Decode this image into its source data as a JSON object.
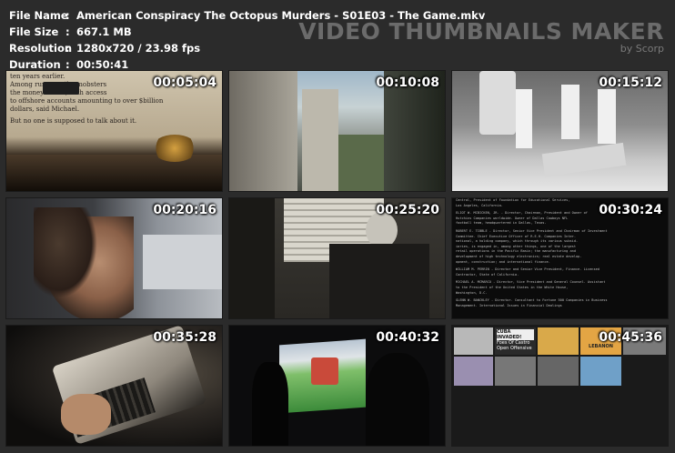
{
  "info": {
    "rows": [
      {
        "key": "File Name",
        "sep": ":",
        "value": "American Conspiracy The Octopus Murders - S01E03 - The Game.mkv"
      },
      {
        "key": "File Size",
        "sep": ":",
        "value": "667.1 MB"
      },
      {
        "key": "Resolution",
        "sep": ":",
        "value": "1280x720 / 23.98 fps"
      },
      {
        "key": "Duration",
        "sep": ":",
        "value": "00:50:41"
      }
    ]
  },
  "brand": {
    "title": "VIDEO THUMBNAILS MAKER",
    "subtitle": "by Scorp"
  },
  "thumbnails": [
    {
      "timestamp": "00:05:04",
      "scene": "typewriter page close-up",
      "text_lines": [
        "ten years earlier.",
        "Among         runners, the mobsters",
        "               the money trader, with access",
        "to offshore accounts amounting to over $billion",
        "dollars, said Michael.",
        "But no one is supposed to talk about it."
      ]
    },
    {
      "timestamp": "00:10:08",
      "scene": "city street between buildings"
    },
    {
      "timestamp": "00:15:12",
      "scene": "black and white archival footage"
    },
    {
      "timestamp": "00:20:16",
      "scene": "man driving car"
    },
    {
      "timestamp": "00:25:20",
      "scene": "person at desk near window"
    },
    {
      "timestamp": "00:30:24",
      "scene": "document text on screen",
      "text_lines": [
        "Central, President of Foundation for Educational Services,",
        "Los Angeles, California.",
        "ELIOT W. MCBICKEN, JR. - Director, Chairman, President and Owner of",
        "Hutchins Companies worldwide. Owner of Dallas Cowboys NFL",
        "football team, headquartered in Dallas, Texas.",
        "ROBERT E. TIBBLE - Director, Senior Vice President and Chairman of Investment",
        "Committee. Chief Executive Officer of R.E.H. Companies Inter-",
        "national, a holding company, which through its various subsid-",
        "iaries, is engaged in, among other things, one of the largest",
        "retail operations in the Pacific Basin; the manufacturing and",
        "development of high technology electronics; real estate develop-",
        "opment, construction; and international finance.",
        "WILLIAM M. PERRIN - Director and Senior Vice President, Finance. Licensed",
        "Contractor, State of California.",
        "MICHAEL A. MCMARCO - Director, Vice President and General Counsel. Assistant",
        "to the President of the United States in the White House,",
        "Washington, D.C.",
        "GLENN W. BANCKLEY - Director. Consultant to Fortune 500 Companies in Business",
        "Management. International Issues in Financial Dealings"
      ]
    },
    {
      "timestamp": "00:35:28",
      "scene": "hands typing on typewriter"
    },
    {
      "timestamp": "00:40:32",
      "scene": "projected film in dark room"
    },
    {
      "timestamp": "00:45:36",
      "scene": "montage of news clippings and maps",
      "text_lines": [
        "CUBA INVADED!",
        "Foes Of Castro Open Offensive",
        "LEBANON"
      ]
    }
  ],
  "colors": {
    "background": "#2b2b2b",
    "info_text": "#ffffff",
    "brand_text": "#6b6b6b",
    "timestamp": "#ffffff"
  }
}
